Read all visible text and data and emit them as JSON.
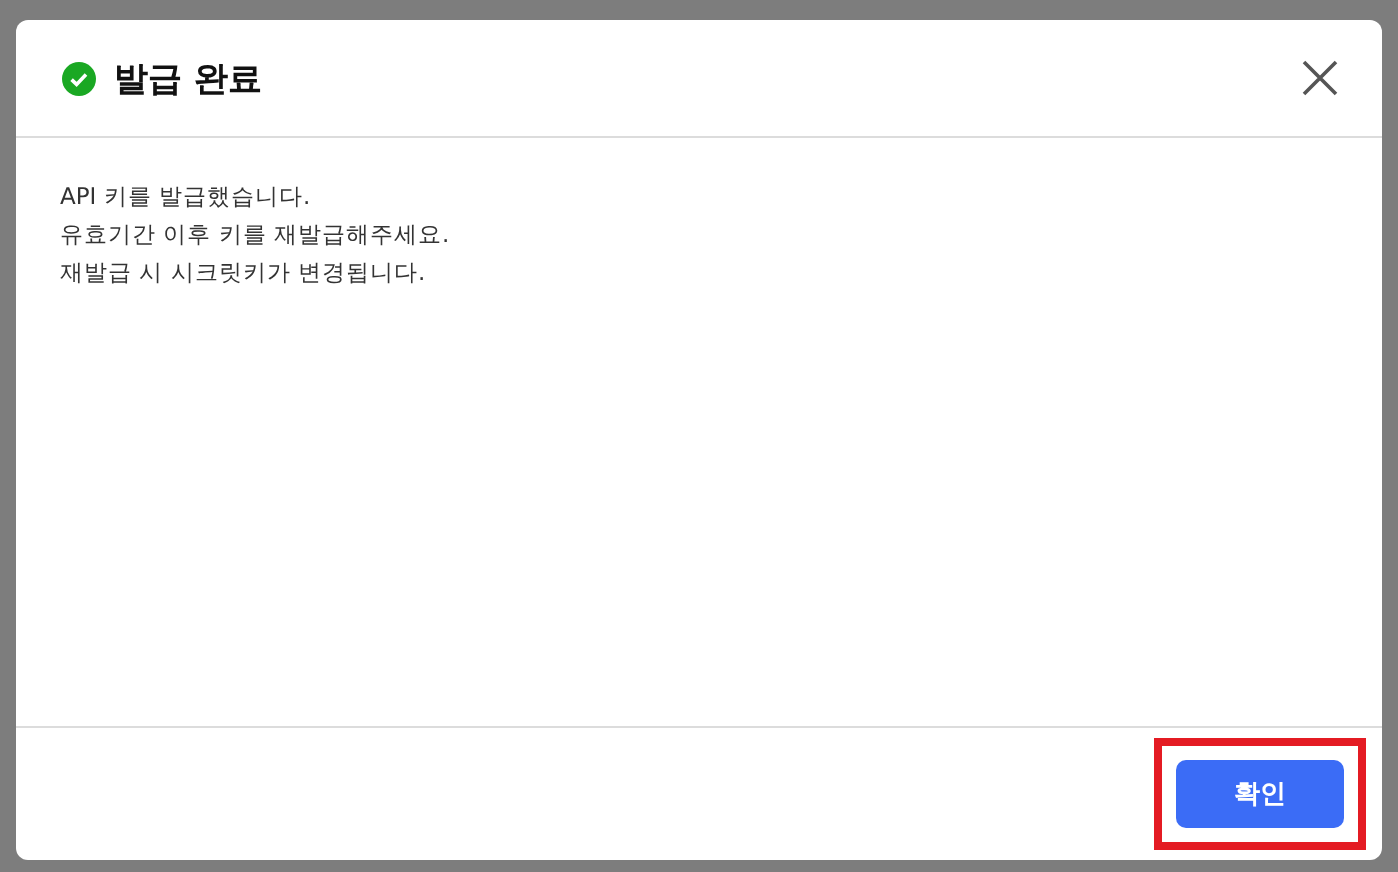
{
  "dialog": {
    "title": "발급 완료",
    "message": [
      "API 키를 발급했습니다.",
      "유효기간 이후 키를 재발급해주세요.",
      "재발급 시 시크릿키가 변경됩니다."
    ],
    "buttons": [
      {
        "label": "확인",
        "kind": "primary",
        "highlighted": true
      }
    ]
  }
}
